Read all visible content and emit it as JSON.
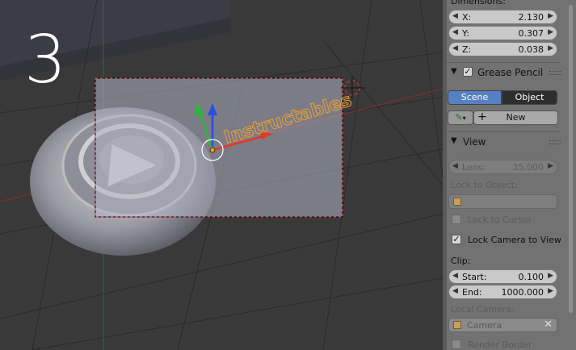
{
  "viewport": {
    "step_number": "3",
    "object_text": "Instructables"
  },
  "panel": {
    "dimensions": {
      "title": "Dimensions:",
      "fields": [
        {
          "label": "X:",
          "value": "2.130"
        },
        {
          "label": "Y:",
          "value": "0.307"
        },
        {
          "label": "Z:",
          "value": "0.038"
        }
      ]
    },
    "grease_pencil": {
      "title": "Grease Pencil",
      "enabled": true,
      "tabs": [
        "Scene",
        "Object"
      ],
      "active_tab": "Scene",
      "new_label": "New"
    },
    "view": {
      "title": "View",
      "lens_label": "Lens:",
      "lens_value": "35.000",
      "lock_to_object_label": "Lock to Object:",
      "lock_to_cursor_label": "Lock to Cursor",
      "lock_to_cursor_checked": false,
      "lock_camera_label": "Lock Camera to View",
      "lock_camera_checked": true,
      "clip_label": "Clip:",
      "clip_start_label": "Start:",
      "clip_start_value": "0.100",
      "clip_end_label": "End:",
      "clip_end_value": "1000.000",
      "local_camera_label": "Local Camera:",
      "local_camera_value": "Camera",
      "render_border_label": "Render Border",
      "render_border_checked": false
    }
  },
  "colors": {
    "accent_blue": "#5680c2",
    "viewport_bg": "#393939",
    "panel_bg": "#727272"
  }
}
